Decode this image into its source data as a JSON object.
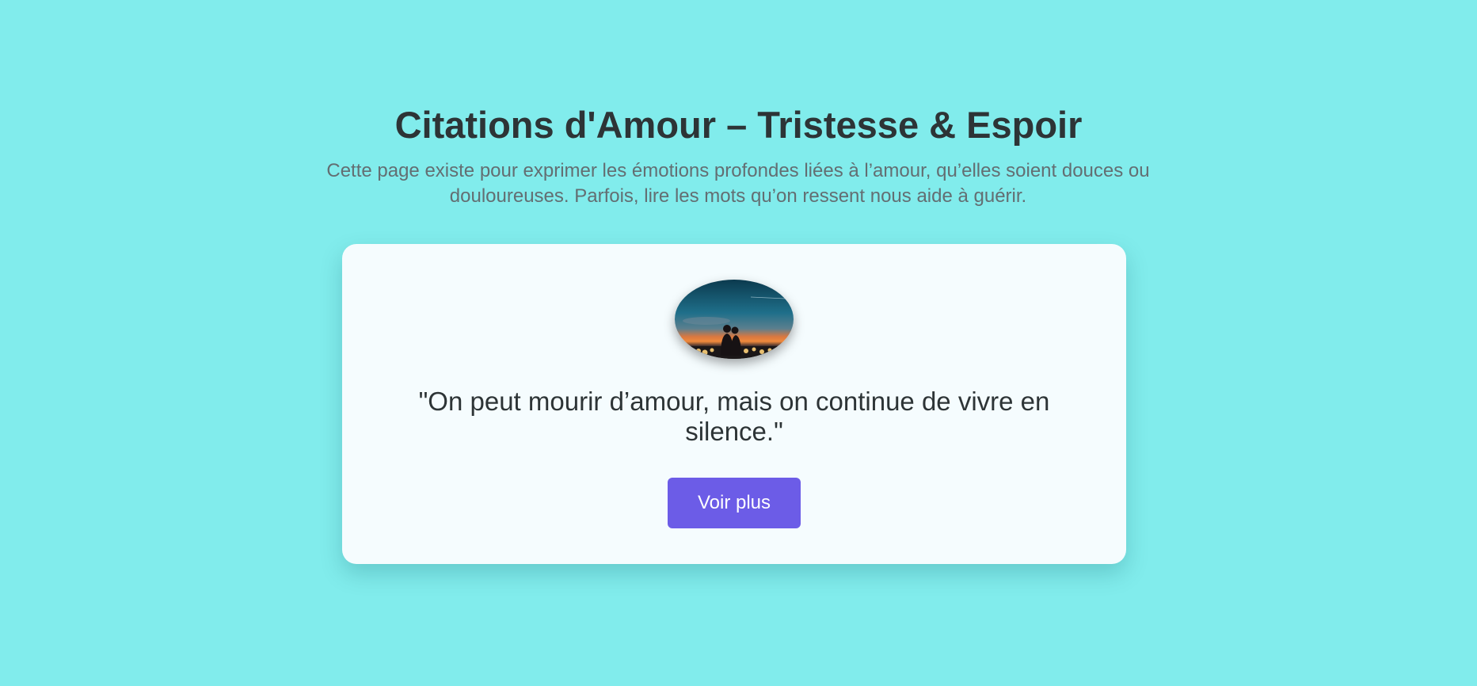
{
  "header": {
    "title": "Citations d'Amour – Tristesse & Espoir",
    "intro": "Cette page existe pour exprimer les émotions profondes liées à l’amour, qu’elles soient douces ou douloureuses. Parfois, lire les mots qu’on ressent nous aide à guérir."
  },
  "card": {
    "image_icon": "couple-sunset-photo",
    "quote": "\"On peut mourir d’amour, mais on continue de vivre en silence.\"",
    "button_label": "Voir plus"
  },
  "colors": {
    "background": "#81ecec",
    "title": "#2d3436",
    "intro": "#636e72",
    "card": "#f5fcfe",
    "button": "#6c5ce7",
    "button_text": "#ffffff"
  }
}
